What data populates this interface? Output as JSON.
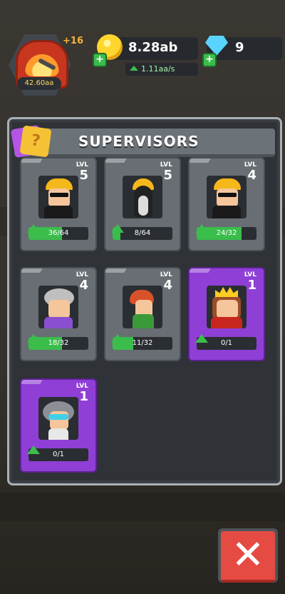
{
  "hud": {
    "speed_value": "42.60aa",
    "speed_bonus": "+16",
    "cash_value": "8.28ab",
    "cash_rate": "1.11aa/s",
    "gems_value": "9"
  },
  "panel": {
    "title": "SUPERVISORS",
    "q_badge": "?"
  },
  "supervisors": [
    {
      "lvl_label": "LVL",
      "level": "5",
      "progress": "36/64",
      "fraction": 0.5625,
      "rarity": "common"
    },
    {
      "lvl_label": "LVL",
      "level": "5",
      "progress": "8/64",
      "fraction": 0.125,
      "rarity": "common"
    },
    {
      "lvl_label": "LVL",
      "level": "4",
      "progress": "24/32",
      "fraction": 0.75,
      "rarity": "common"
    },
    {
      "lvl_label": "LVL",
      "level": "4",
      "progress": "18/32",
      "fraction": 0.5625,
      "rarity": "common"
    },
    {
      "lvl_label": "LVL",
      "level": "4",
      "progress": "11/32",
      "fraction": 0.34375,
      "rarity": "common"
    },
    {
      "lvl_label": "LVL",
      "level": "1",
      "progress": "0/1",
      "fraction": 0,
      "rarity": "epic"
    },
    {
      "lvl_label": "LVL",
      "level": "1",
      "progress": "0/1",
      "fraction": 0,
      "rarity": "epic"
    }
  ],
  "close_button": {
    "label": "✕"
  },
  "colors": {
    "accent_green": "#3bbd4c",
    "epic_purple": "#8f3fd6",
    "close_red": "#e54b42"
  }
}
